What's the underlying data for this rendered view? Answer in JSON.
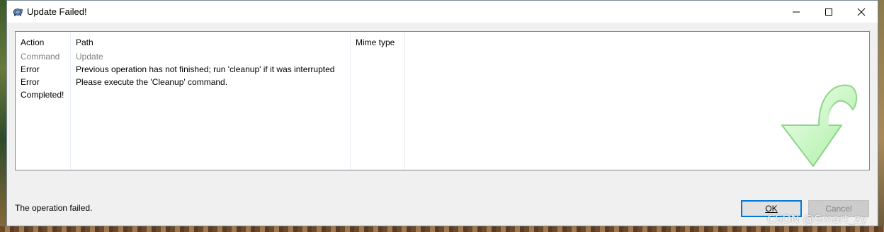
{
  "window": {
    "title": "Update Failed!",
    "title_icon": "tortoise-icon",
    "controls": [
      "minimize-icon",
      "maximize-icon",
      "close-icon"
    ]
  },
  "list": {
    "columns": [
      "Action",
      "Path",
      "Mime type"
    ],
    "rows": [
      {
        "action": "Command",
        "path": "Update",
        "dim": true
      },
      {
        "action": "Error",
        "path": "Previous operation has not finished; run 'cleanup' if it was interrupted",
        "dim": false
      },
      {
        "action": "Error",
        "path": "Please execute the 'Cleanup' command.",
        "dim": false
      },
      {
        "action": "Completed!",
        "path": "",
        "dim": false
      }
    ],
    "watermark_icon": "curved-down-arrow-icon"
  },
  "footer": {
    "status": "The operation failed.",
    "ok_label": "OK",
    "cancel_label": "Cancel"
  },
  "overlay": {
    "watermark_text": "CSDN @Smart_zy"
  },
  "colors": {
    "accent": "#0078d7",
    "dim_text": "#808080",
    "arrow_green": "#b8f5b0"
  }
}
